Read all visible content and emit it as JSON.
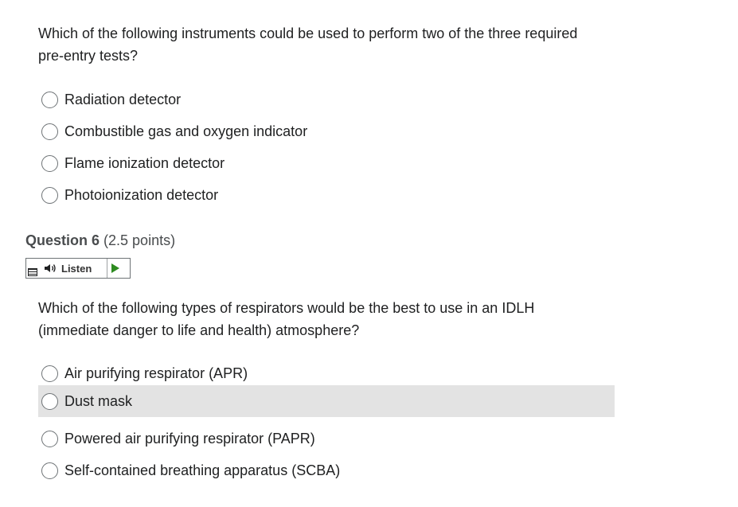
{
  "question5": {
    "text": "Which of the following instruments could be used to perform two of the three required pre-entry tests?",
    "options": [
      "Radiation detector",
      "Combustible gas and oxygen indicator",
      "Flame ionization detector",
      "Photoionization detector"
    ]
  },
  "question6": {
    "title": "Question 6",
    "points": "(2.5 points)",
    "listen_label": "Listen",
    "text": "Which of the following types of respirators would be the best to use in an IDLH (immediate danger to life and health) atmosphere?",
    "options": [
      "Air purifying respirator (APR)",
      "Dust mask",
      "Powered air purifying respirator (PAPR)",
      "Self-contained breathing apparatus (SCBA)"
    ]
  },
  "icons": {
    "menu": "menu-icon",
    "speaker": "speaker-icon",
    "play": "play-icon"
  },
  "colors": {
    "text": "#202122",
    "header": "#494c4e",
    "hover_row": "#e3e3e3",
    "play": "#2e8b20",
    "radio_border": "#6e7376"
  }
}
